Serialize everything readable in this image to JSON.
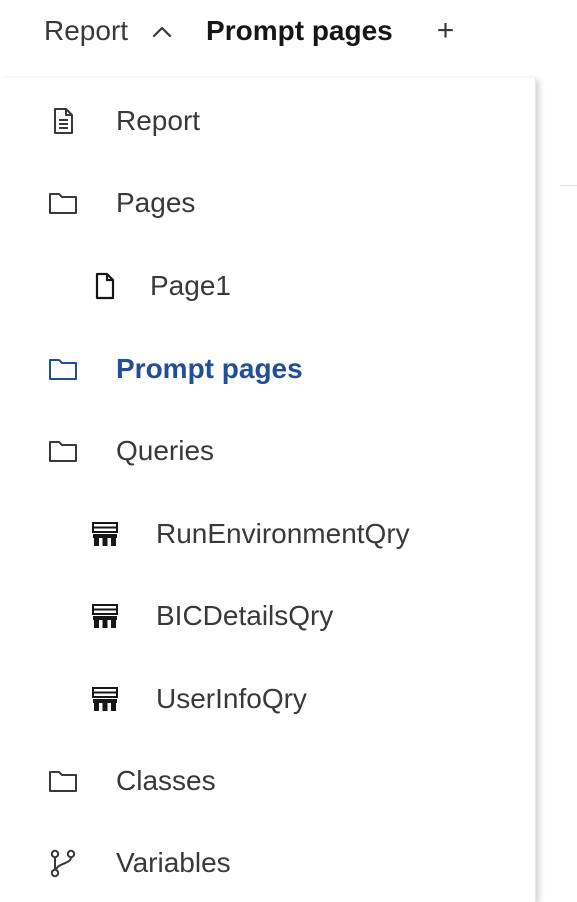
{
  "header": {
    "report_label": "Report",
    "current_page": "Prompt pages",
    "add_label": "+"
  },
  "tree": {
    "report": "Report",
    "pages": "Pages",
    "page1": "Page1",
    "prompt_pages": "Prompt pages",
    "queries": "Queries",
    "query_items": [
      "RunEnvironmentQry",
      "BICDetailsQry",
      "UserInfoQry"
    ],
    "classes": "Classes",
    "variables": "Variables"
  },
  "colors": {
    "active": "#214e9a",
    "text": "#393939",
    "icon": "#393939"
  },
  "icons": {
    "report": "document-icon",
    "pages": "folder-icon",
    "page1": "page-icon",
    "prompt_pages": "folder-icon",
    "queries": "folder-icon",
    "query": "table-icon",
    "classes": "folder-icon",
    "variables": "branch-icon"
  }
}
